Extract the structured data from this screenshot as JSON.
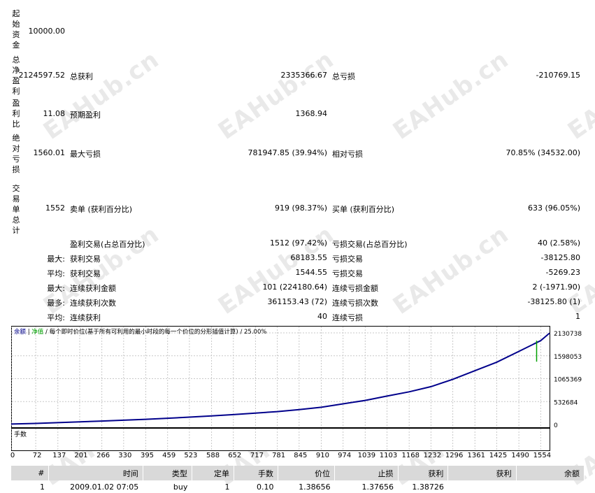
{
  "summary": {
    "initial_deposit": {
      "label": "起始资金",
      "value": "10000.00"
    },
    "net_profit": {
      "label": "总净盈利",
      "value": "2124597.52",
      "gross_profit_label": "总获利",
      "gross_profit": "2335366.67",
      "gross_loss_label": "总亏损",
      "gross_loss": "-210769.15"
    },
    "profit_factor": {
      "label": "盈利比",
      "value": "11.08",
      "expected_payoff_label": "预期盈利",
      "expected_payoff": "1368.94"
    },
    "abs_drawdown": {
      "label": "绝对亏损",
      "value": "1560.01",
      "max_dd_label": "最大亏损",
      "max_dd": "781947.85 (39.94%)",
      "rel_dd_label": "相对亏损",
      "rel_dd": "70.85% (34532.00)"
    },
    "total_trades": {
      "label": "交易单总计",
      "value": "1552",
      "short_label": "卖单 (获利百分比)",
      "short": "919 (98.37%)",
      "long_label": "买单 (获利百分比)",
      "long": "633 (96.05%)"
    }
  },
  "stats": [
    {
      "prefix": "",
      "l1": "盈利交易(占总百分比)",
      "v1": "1512 (97.42%)",
      "l2": "亏损交易(占总百分比)",
      "v2": "40 (2.58%)"
    },
    {
      "prefix": "最大:",
      "l1": "获利交易",
      "v1": "68183.55",
      "l2": "亏损交易",
      "v2": "-38125.80"
    },
    {
      "prefix": "平均:",
      "l1": "获利交易",
      "v1": "1544.55",
      "l2": "亏损交易",
      "v2": "-5269.23"
    },
    {
      "prefix": "最大:",
      "l1": "连续获利金额",
      "v1": "101 (224180.64)",
      "l2": "连续亏损金额",
      "v2": "2 (-1971.90)"
    },
    {
      "prefix": "最多:",
      "l1": "连续获利次数",
      "v1": "361153.43 (72)",
      "l2": "连续亏损次数",
      "v2": "-38125.80 (1)"
    },
    {
      "prefix": "平均:",
      "l1": "连续获利",
      "v1": "40",
      "l2": "连续亏损",
      "v2": "1"
    }
  ],
  "chart_header": {
    "balance": "余额",
    "equity": "净值",
    "note": "每个即时价位(基于所有可利用的最小时段的每一个价位的分形插值计算)",
    "sep": "/",
    "quality": "25.00%"
  },
  "lot_panel_label": "手数",
  "chart_data": {
    "type": "line",
    "x_ticks": [
      "0",
      "72",
      "137",
      "201",
      "266",
      "330",
      "395",
      "459",
      "523",
      "588",
      "652",
      "717",
      "781",
      "845",
      "910",
      "974",
      "1039",
      "1103",
      "1168",
      "1232",
      "1296",
      "1361",
      "1425",
      "1490",
      "1554"
    ],
    "y_ticks": [
      "2130738",
      "1598053",
      "1065369",
      "532684",
      "0"
    ],
    "ylim": [
      0,
      2130738
    ],
    "xlim": [
      0,
      1580
    ],
    "series": [
      {
        "name": "余额",
        "color": "#00008b",
        "x": [
          0,
          72,
          137,
          201,
          266,
          330,
          395,
          459,
          523,
          588,
          652,
          717,
          781,
          845,
          910,
          974,
          1039,
          1103,
          1168,
          1232,
          1296,
          1361,
          1425,
          1490,
          1554,
          1580
        ],
        "values": [
          10000,
          25000,
          42000,
          60000,
          80000,
          100000,
          120000,
          145000,
          170000,
          200000,
          230000,
          265000,
          300000,
          345000,
          400000,
          480000,
          560000,
          660000,
          760000,
          880000,
          1050000,
          1250000,
          1450000,
          1700000,
          1950000,
          2124597
        ]
      },
      {
        "name": "净值",
        "color": "#00a000",
        "x": [
          1542,
          1542
        ],
        "values": [
          1950000,
          1460000
        ]
      }
    ]
  },
  "table": {
    "headers": [
      "#",
      "时间",
      "类型",
      "定单",
      "手数",
      "价位",
      "止损",
      "获利",
      "获利",
      "余额"
    ],
    "rows": [
      [
        "1",
        "2009.01.02 07:05",
        "buy",
        "1",
        "0.10",
        "1.38656",
        "1.37656",
        "1.38726",
        "",
        ""
      ]
    ]
  },
  "watermark_text": "EAHub.cn"
}
